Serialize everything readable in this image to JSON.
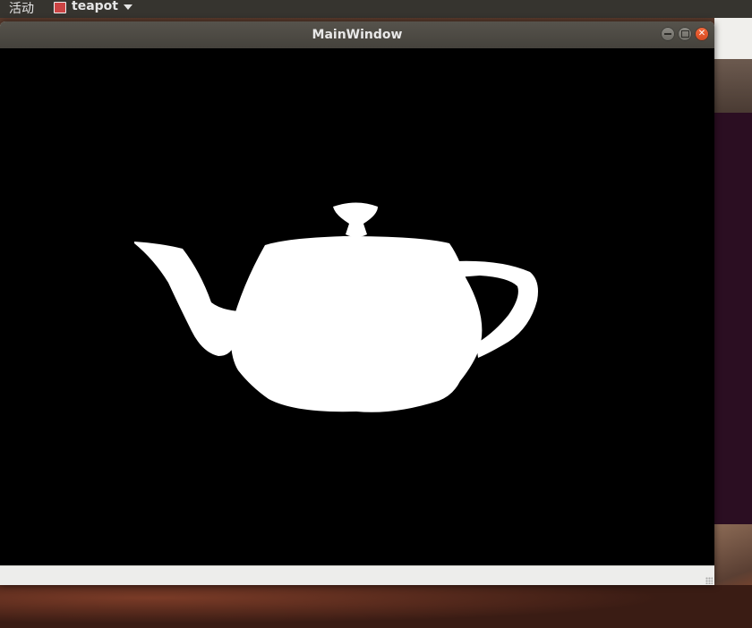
{
  "topbar": {
    "activities": "活动",
    "app_name": "teapot"
  },
  "window": {
    "title": "MainWindow"
  },
  "icons": {
    "app": "app-icon",
    "dropdown": "caret-down-icon",
    "minimize": "minimize-icon",
    "maximize": "maximize-icon",
    "close": "close-icon"
  },
  "colors": {
    "topbar": "#36342f",
    "titlebar": "#4b4842",
    "canvas": "#000000",
    "teapot": "#ffffff",
    "close_button": "#e95420"
  }
}
